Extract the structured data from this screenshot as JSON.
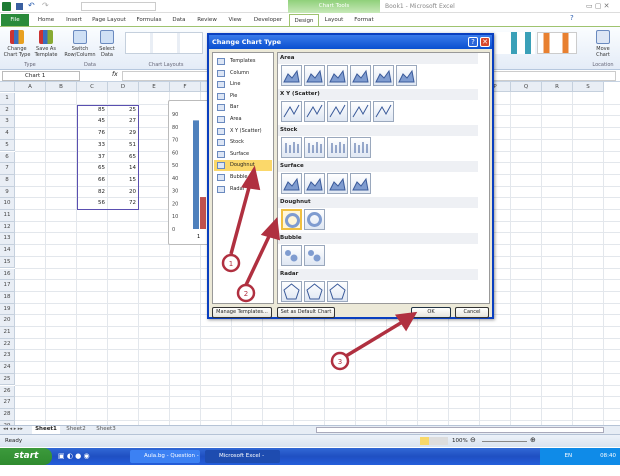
{
  "window": {
    "title": "Book1 - Microsoft Excel",
    "context_tab": "Chart Tools"
  },
  "quick_access": {
    "customize": "▾"
  },
  "tabs": [
    "File",
    "Home",
    "Insert",
    "Page Layout",
    "Formulas",
    "Data",
    "Review",
    "View",
    "Developer",
    "Design",
    "Layout",
    "Format"
  ],
  "ribbon": {
    "buttons": [
      {
        "label": "Change Chart Type"
      },
      {
        "label": "Save As Template"
      },
      {
        "label": "Switch Row/Column"
      },
      {
        "label": "Select Data"
      },
      {
        "label": "Move Chart"
      }
    ],
    "groups": [
      "Type",
      "Data",
      "Chart Layouts",
      "Location"
    ]
  },
  "formula_bar": {
    "name_box": "Chart 1",
    "fx": "fx",
    "value": ""
  },
  "grid": {
    "columns": [
      "A",
      "B",
      "C",
      "D",
      "E",
      "F",
      "G",
      "H",
      "I",
      "J",
      "K",
      "L",
      "M",
      "N",
      "O",
      "P",
      "Q",
      "R",
      "S"
    ],
    "rows": [
      "1",
      "2",
      "3",
      "4",
      "5",
      "6",
      "7",
      "8",
      "9",
      "10",
      "11",
      "12",
      "13",
      "14",
      "15",
      "16",
      "17",
      "18",
      "19",
      "20",
      "21",
      "22",
      "23",
      "24",
      "25",
      "26",
      "27",
      "28",
      "29"
    ],
    "col_c": [
      85,
      45,
      76,
      33,
      37,
      65,
      66,
      82,
      56
    ],
    "col_d": [
      25,
      27,
      29,
      51,
      65,
      14,
      15,
      20,
      72
    ]
  },
  "chart_data": {
    "type": "bar",
    "categories": [
      "1"
    ],
    "series": [
      {
        "values": [
          85
        ],
        "color": "#4f81bd"
      },
      {
        "values": [
          25
        ],
        "color": "#c0504d"
      }
    ],
    "yticks": [
      "0",
      "10",
      "20",
      "30",
      "40",
      "50",
      "60",
      "70",
      "80",
      "90"
    ],
    "ylim": [
      0,
      90
    ]
  },
  "dialog": {
    "title": "Change Chart Type",
    "types": [
      "Templates",
      "Column",
      "Line",
      "Pie",
      "Bar",
      "Area",
      "X Y (Scatter)",
      "Stock",
      "Surface",
      "Doughnut",
      "Bubble",
      "Radar"
    ],
    "selected_type": "Doughnut",
    "sections": [
      {
        "name": "Area",
        "count": 6
      },
      {
        "name": "X Y (Scatter)",
        "count": 5
      },
      {
        "name": "Stock",
        "count": 4
      },
      {
        "name": "Surface",
        "count": 4
      },
      {
        "name": "Doughnut",
        "count": 2
      },
      {
        "name": "Bubble",
        "count": 2
      },
      {
        "name": "Radar",
        "count": 3
      }
    ],
    "manage_templates": "Manage Templates...",
    "set_default": "Set as Default Chart",
    "ok": "OK",
    "cancel": "Cancel",
    "help": "?",
    "close": "✕"
  },
  "annotations": [
    "1",
    "2",
    "3"
  ],
  "sheets": [
    "Sheet1",
    "Sheet2",
    "Sheet3"
  ],
  "status": {
    "ready": "Ready",
    "zoom": "100%"
  },
  "taskbar": {
    "start": "start",
    "tasks": [
      "Aula.bg - Question - ...",
      "Microsoft Excel - Book1"
    ],
    "lang": "EN",
    "time": "08:40"
  },
  "colors": {
    "accent": "#1f4fc2",
    "annotation": "#b03040",
    "selected": "#fbd86a"
  }
}
